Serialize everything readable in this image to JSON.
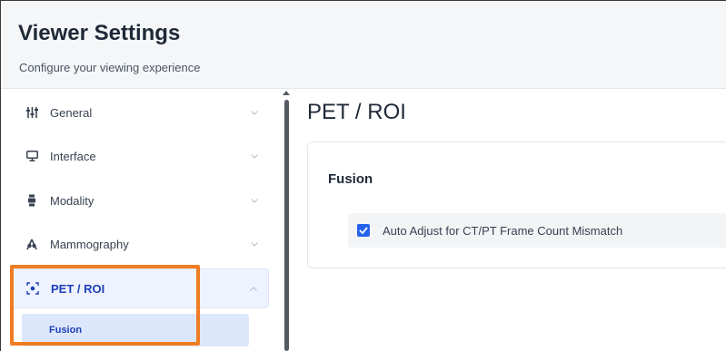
{
  "header": {
    "title": "Viewer Settings",
    "subtitle": "Configure your viewing experience"
  },
  "sidebar": {
    "items": [
      {
        "label": "General",
        "icon": "sliders-icon",
        "expanded": false
      },
      {
        "label": "Interface",
        "icon": "monitor-icon",
        "expanded": false
      },
      {
        "label": "Modality",
        "icon": "modality-icon",
        "expanded": false
      },
      {
        "label": "Mammography",
        "icon": "mammography-icon",
        "expanded": false
      },
      {
        "label": "PET / ROI",
        "icon": "pet-roi-icon",
        "expanded": true,
        "active": true
      }
    ],
    "subitems": [
      {
        "label": "Fusion",
        "selected": true
      }
    ]
  },
  "main": {
    "title": "PET / ROI",
    "section": {
      "title": "Fusion",
      "options": [
        {
          "label": "Auto Adjust for CT/PT Frame Count Mismatch",
          "checked": true
        }
      ]
    }
  },
  "colors": {
    "accent": "#1d3fb8",
    "checkbox": "#2563eb",
    "highlight": "#f07c22",
    "header_bg": "#f4f6f8"
  }
}
